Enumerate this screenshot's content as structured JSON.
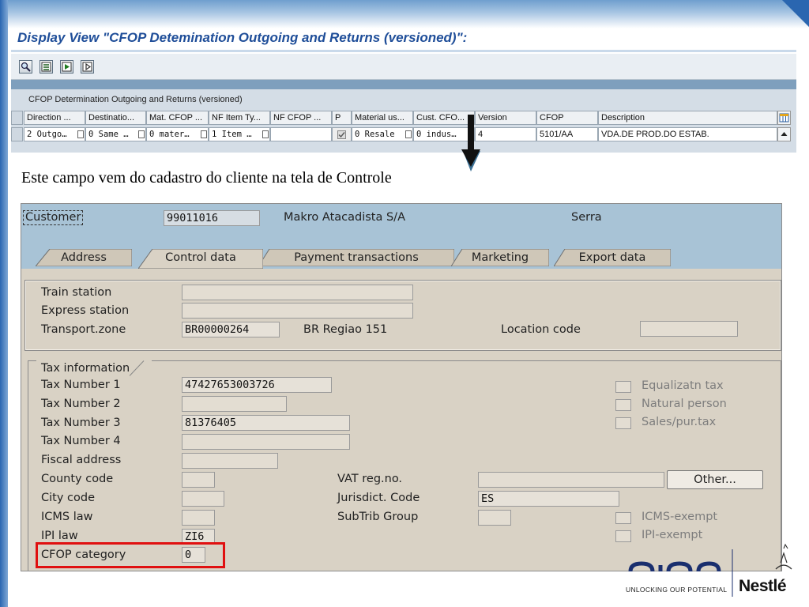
{
  "upper_screen": {
    "title": "Display View \"CFOP Detemination Outgoing and Returns (versioned)\":",
    "toolbar_icons": [
      "find-icon",
      "table-view-icon",
      "export-icon",
      "print-icon"
    ],
    "table_title": "CFOP Determination Outgoing and Returns (versioned)",
    "columns": [
      "Direction ...",
      "Destinatio...",
      "Mat. CFOP ...",
      "NF Item Ty...",
      "NF CFOP ...",
      "P",
      "Material us...",
      "Cust. CFO...",
      "Version",
      "CFOP",
      "Description"
    ],
    "row": [
      "2 Outgo…",
      "0 Same …",
      "0 mater…",
      "1 Item …",
      "",
      "checked",
      "0 Resale",
      "0 indus…",
      "4",
      "5101/AA",
      "VDA.DE PROD.DO ESTAB."
    ]
  },
  "caption": "Este campo vem do cadastro do cliente na tela de Controle",
  "customer": {
    "label": "Customer",
    "number": "99011016",
    "name": "Makro Atacadista S/A",
    "city": "Serra"
  },
  "tabs": [
    {
      "label": "Address",
      "active": false
    },
    {
      "label": "Control data",
      "active": true
    },
    {
      "label": "Payment transactions",
      "active": false
    },
    {
      "label": "Marketing",
      "active": false
    },
    {
      "label": "Export data",
      "active": false
    }
  ],
  "transport_group": {
    "train_station_label": "Train station",
    "train_station_value": "",
    "express_station_label": "Express station",
    "express_station_value": "",
    "transport_zone_label": "Transport.zone",
    "transport_zone_value": "BR00000264",
    "transport_zone_desc": "BR Regiao 151",
    "location_code_label": "Location code",
    "location_code_value": ""
  },
  "tax_information": {
    "title": "Tax information",
    "tax_number_1_label": "Tax Number 1",
    "tax_number_1_value": "47427653003726",
    "tax_number_2_label": "Tax Number 2",
    "tax_number_2_value": "",
    "tax_number_3_label": "Tax Number 3",
    "tax_number_3_value": "81376405",
    "tax_number_4_label": "Tax Number 4",
    "tax_number_4_value": "",
    "fiscal_address_label": "Fiscal address",
    "county_code_label": "County code",
    "city_code_label": "City code",
    "icms_law_label": "ICMS law",
    "ipi_law_label": "IPI law",
    "ipi_law_value": "ZI6",
    "cfop_category_label": "CFOP category",
    "cfop_category_value": "0",
    "vat_reg_label": "VAT reg.no.",
    "jurisdict_code_label": "Jurisdict. Code",
    "jurisdict_code_value": "ES",
    "subtrib_group_label": "SubTrib Group",
    "other_button": "Other...",
    "equalizatn_tax_label": "Equalizatn tax",
    "natural_person_label": "Natural person",
    "sales_pur_tax_label": "Sales/pur.tax",
    "icms_exempt_label": "ICMS-exempt",
    "ipi_exempt_label": "IPI-exempt"
  },
  "logos": {
    "globo_tagline": "UNLOCKING OUR POTENTIAL",
    "nestle": "Nestlé"
  },
  "colors": {
    "title_blue": "#1f4e99",
    "sap_header": "#a8c3d6",
    "sap_panel": "#d9d2c5",
    "highlight_red": "#e01010"
  }
}
